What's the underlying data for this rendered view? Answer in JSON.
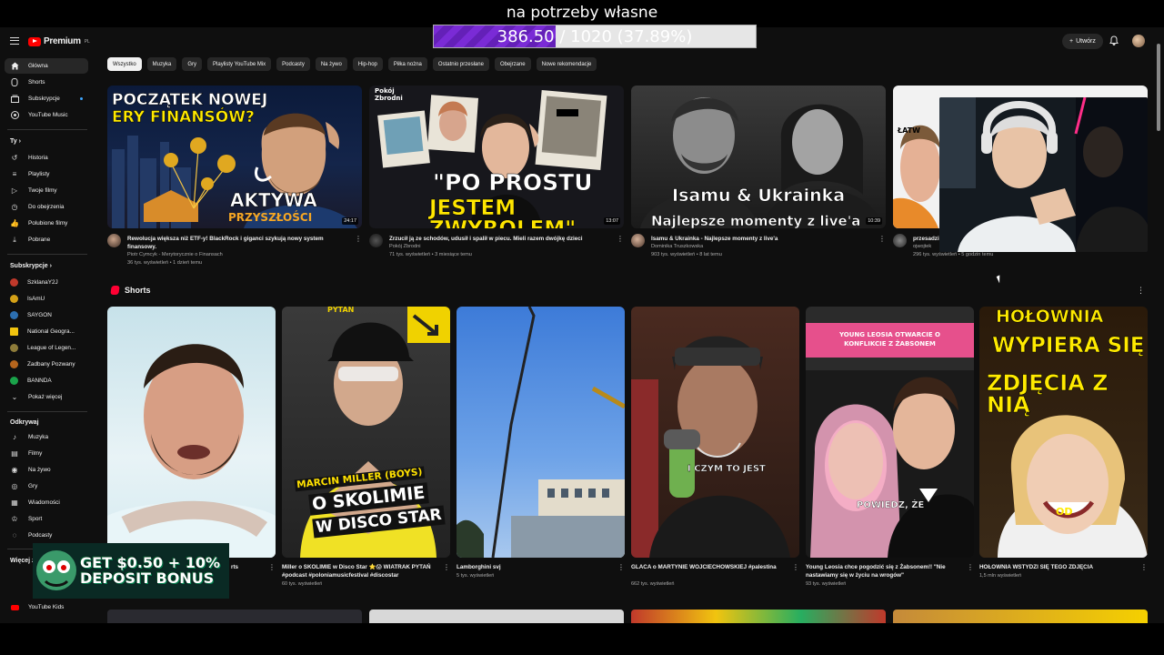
{
  "overlay": {
    "goal_text": "na potrzeby własne",
    "goal_current": "386.50",
    "goal_rest": " / 1020 (37.89%)",
    "goal_fraction": 0.3789
  },
  "header": {
    "logo_text": "Premium",
    "logo_sup": "PL",
    "create_label": "Utwórz"
  },
  "sidebar": {
    "main": [
      {
        "label": "Główna",
        "icon": "home-icon"
      },
      {
        "label": "Shorts",
        "icon": "shorts-icon"
      },
      {
        "label": "Subskrypcje",
        "icon": "subscriptions-icon"
      },
      {
        "label": "YouTube Music",
        "icon": "music-icon"
      }
    ],
    "you_heading": "Ty",
    "you": [
      {
        "label": "Historia",
        "icon": "history-icon"
      },
      {
        "label": "Playlisty",
        "icon": "playlist-icon"
      },
      {
        "label": "Twoje filmy",
        "icon": "your-videos-icon"
      },
      {
        "label": "Do obejrzenia",
        "icon": "watch-later-icon"
      },
      {
        "label": "Polubione filmy",
        "icon": "liked-icon"
      },
      {
        "label": "Pobrane",
        "icon": "download-icon"
      }
    ],
    "subs_heading": "Subskrypcje",
    "subs": [
      {
        "label": "SzklanaY2J",
        "color": "#c0392b"
      },
      {
        "label": "IsAmU",
        "color": "#d4a017"
      },
      {
        "label": "SAYGON",
        "color": "#2c6fb0"
      },
      {
        "label": "National Geogra...",
        "color": "#f1c40f"
      },
      {
        "label": "League of Legen...",
        "color": "#8e7c3a"
      },
      {
        "label": "Zadbany Pozwany",
        "color": "#b5651d"
      },
      {
        "label": "BANNDA",
        "color": "#1aa34a"
      },
      {
        "label": "Pokaż więcej",
        "color": ""
      }
    ],
    "explore_heading": "Odkrywaj",
    "explore": [
      {
        "label": "Muzyka",
        "icon": "music-note-icon"
      },
      {
        "label": "Filmy",
        "icon": "film-icon"
      },
      {
        "label": "Na żywo",
        "icon": "live-icon"
      },
      {
        "label": "Gry",
        "icon": "gaming-icon"
      },
      {
        "label": "Wiadomości",
        "icon": "news-icon"
      },
      {
        "label": "Sport",
        "icon": "trophy-icon"
      },
      {
        "label": "Podcasty",
        "icon": "podcast-icon"
      }
    ],
    "more_heading": "Więcej z",
    "youtube_kids": "YouTube Kids"
  },
  "chips": [
    "Wszystko",
    "Muzyka",
    "Gry",
    "Playlisty YouTube Mix",
    "Podcasty",
    "Na żywo",
    "Hip-hop",
    "Piłka nożna",
    "Ostatnio przesłane",
    "Obejrzane",
    "Nowe rekomendacje"
  ],
  "videos": [
    {
      "title": "Rewolucja większa niż ETF-y! BlackRock i giganci szykują nowy system finansowy.",
      "channel": "Piotr Cymcyk - Merytorycznie o Finansach",
      "stats": "36 tys. wyświetleń • 1 dzień temu",
      "duration": "24:17",
      "overlay1": "POCZĄTEK NOWEJ",
      "overlay2": "ERY FINANSÓW?",
      "overlay3": "AKTYWA",
      "overlay4": "PRZYSZŁOŚCI"
    },
    {
      "title": "Zrzucił ją ze schodów, udusił i spalił w piecu. Mieli razem dwójkę dzieci",
      "channel": "Pokój Zbrodni",
      "stats": "71 tys. wyświetleń • 3 miesiące temu",
      "duration": "13:07",
      "overlay1": "Pokój Zbrodni",
      "overlay2": "\"PO PROSTU",
      "overlay3": "JESTEM ZWYROLEM\""
    },
    {
      "title": "Isamu & Ukrainka - Najlepsze momenty z live'a",
      "channel": "Dominika Truszkowska",
      "stats": "903 tys. wyświetleń • 8 lat temu",
      "duration": "10:39",
      "overlay1": "Isamu & Ukrainka",
      "overlay2": "Najlepsze momenty z live'a"
    },
    {
      "title": "przesadzi",
      "channel": "ojwojtek",
      "stats": "296 tys. wyświetleń • 5 godzin temu",
      "overlay1": "ŁATW"
    }
  ],
  "shorts_heading": "Shorts",
  "shorts": [
    {
      "title": "rts",
      "views": "",
      "overlay": ""
    },
    {
      "title": "Miller o SKOLIMIE w Disco Star ⭐😱 WIATRAK PYTAŃ #podcast #poloniamusicfestival #discostar",
      "views": "60 tys. wyświetleń",
      "overlay": "MARCIN MILLER (BOYS)",
      "overlay2": "O SKOLIMIE",
      "overlay3": "W DISCO STAR",
      "tag": "PYTAŃ"
    },
    {
      "title": "Lamborghini svj",
      "views": "5 tys. wyświetleń",
      "overlay": ""
    },
    {
      "title": "GLACA o MARTYNIE WOJCIECHOWSKIEJ #palestina",
      "views": "662 tys. wyświetleń",
      "overlay": "I CZYM TO JEST"
    },
    {
      "title": "Young Leosia chce pogodzić się z Żabsonem!! \"Nie nastawiamy się w życiu na wrogów\"",
      "views": "93 tys. wyświetleń",
      "overlay": "YOUNG LEOSIA OTWARCIE O KONFLIKCIE Z ŻABSONEM",
      "overlay2": "POWIEDZ, ŻE"
    },
    {
      "title": "HOŁOWNIA WSTYDZI SIĘ TEGO ZDJĘCIA",
      "views": "1,5 mln wyświetleń",
      "overlay": "HOŁOWNIA",
      "overlay2": "WYPIERA SIĘ",
      "overlay3": "ZDJĘCIA Z NIĄ",
      "overlay4": "OD"
    }
  ],
  "banner": {
    "line1": "GET $0.50 + 10%",
    "line2": "DEPOSIT BONUS"
  }
}
